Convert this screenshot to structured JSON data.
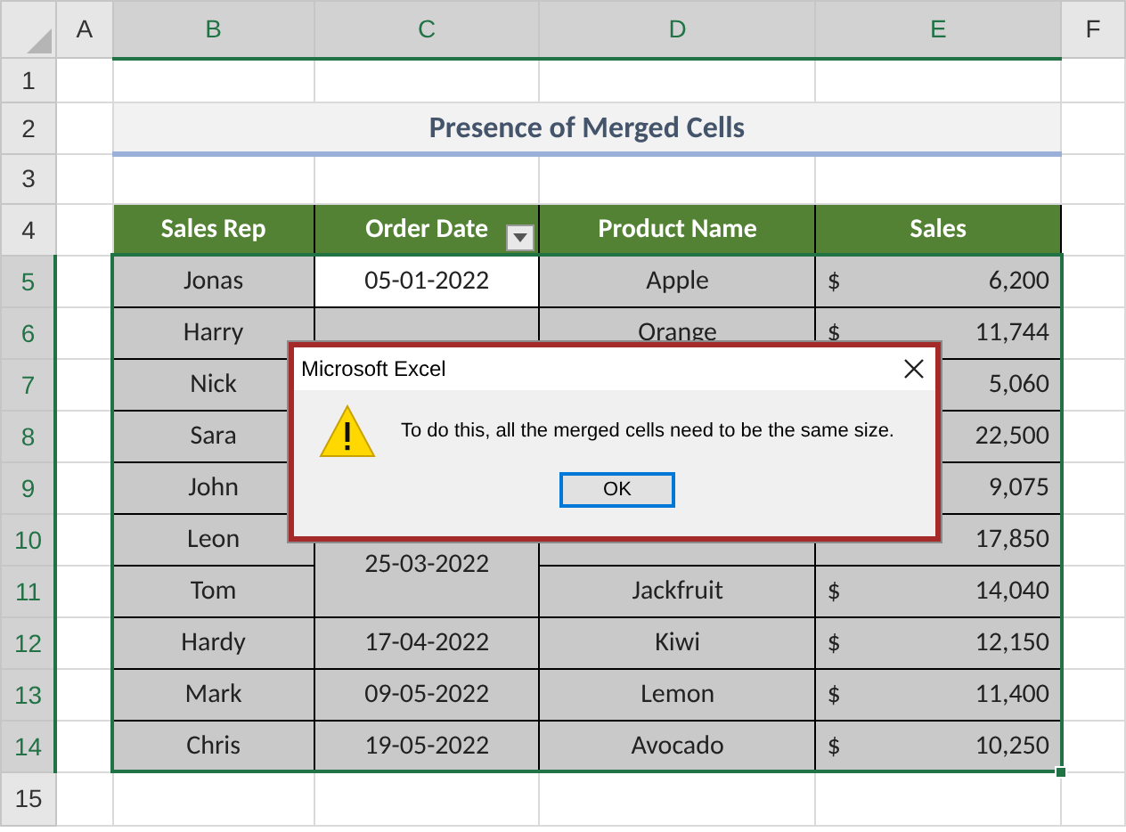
{
  "column_headers": [
    {
      "label": "A",
      "selected": false
    },
    {
      "label": "B",
      "selected": true
    },
    {
      "label": "C",
      "selected": true
    },
    {
      "label": "D",
      "selected": true
    },
    {
      "label": "E",
      "selected": true
    },
    {
      "label": "F",
      "selected": false
    }
  ],
  "row_headers": [
    {
      "label": "1",
      "selected": false
    },
    {
      "label": "2",
      "selected": false
    },
    {
      "label": "3",
      "selected": false
    },
    {
      "label": "4",
      "selected": false
    },
    {
      "label": "5",
      "selected": true
    },
    {
      "label": "6",
      "selected": true
    },
    {
      "label": "7",
      "selected": true
    },
    {
      "label": "8",
      "selected": true
    },
    {
      "label": "9",
      "selected": true
    },
    {
      "label": "10",
      "selected": true
    },
    {
      "label": "11",
      "selected": true
    },
    {
      "label": "12",
      "selected": true
    },
    {
      "label": "13",
      "selected": true
    },
    {
      "label": "14",
      "selected": true
    },
    {
      "label": "15",
      "selected": false
    }
  ],
  "title": "Presence of Merged Cells",
  "table": {
    "columns": [
      {
        "label": "Sales Rep",
        "filter": false
      },
      {
        "label": "Order Date",
        "filter": true
      },
      {
        "label": "Product Name",
        "filter": false
      },
      {
        "label": "Sales",
        "filter": false
      }
    ],
    "rows": [
      {
        "rep": "Jonas",
        "date": "05-01-2022",
        "active": true,
        "product": "Apple",
        "dollar": "$",
        "amount": "6,200"
      },
      {
        "rep": "Harry",
        "active": false,
        "product": "Orange",
        "dollar": "$",
        "amount": "11,744"
      },
      {
        "rep": "Nick",
        "amount": "5,060"
      },
      {
        "rep": "Sara",
        "amount": "22,500"
      },
      {
        "rep": "John",
        "amount": "9,075"
      },
      {
        "rep": "Leon",
        "date": "25-03-2022",
        "date_spans_next": true,
        "active": false,
        "amount": "17,850"
      },
      {
        "rep": "Tom",
        "product": "Jackfruit",
        "dollar": "$",
        "amount": "14,040"
      },
      {
        "rep": "Hardy",
        "date": "17-04-2022",
        "active": false,
        "product": "Kiwi",
        "dollar": "$",
        "amount": "12,150"
      },
      {
        "rep": "Mark",
        "date": "09-05-2022",
        "active": false,
        "product": "Lemon",
        "dollar": "$",
        "amount": "11,400"
      },
      {
        "rep": "Chris",
        "date": "19-05-2022",
        "active": false,
        "product": "Avocado",
        "dollar": "$",
        "amount": "10,250"
      }
    ]
  },
  "dialog": {
    "title": "Microsoft Excel",
    "message": "To do this, all the merged cells need to be the same size.",
    "button": "OK"
  }
}
